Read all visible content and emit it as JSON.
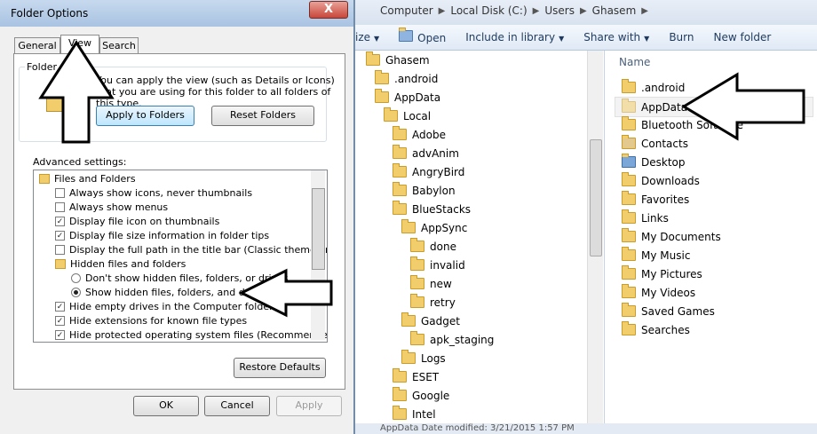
{
  "explorer": {
    "breadcrumb": [
      "Computer",
      "Local Disk (C:)",
      "Users",
      "Ghasem"
    ],
    "toolbar": {
      "organize": "ize",
      "open": "Open",
      "include": "Include in library",
      "share": "Share with",
      "burn": "Burn",
      "new_folder": "New folder"
    },
    "nav_tree": [
      {
        "label": "Ghasem"
      },
      {
        "label": ".android"
      },
      {
        "label": "AppData"
      },
      {
        "label": "Local"
      },
      {
        "label": "Adobe"
      },
      {
        "label": "advAnim"
      },
      {
        "label": "AngryBird"
      },
      {
        "label": "Babylon"
      },
      {
        "label": "BlueStacks"
      },
      {
        "label": "AppSync"
      },
      {
        "label": "done"
      },
      {
        "label": "invalid"
      },
      {
        "label": "new"
      },
      {
        "label": "retry"
      },
      {
        "label": "Gadget"
      },
      {
        "label": "apk_staging"
      },
      {
        "label": "Logs"
      },
      {
        "label": "ESET"
      },
      {
        "label": "Google"
      },
      {
        "label": "Intel"
      }
    ],
    "list_header": "Name",
    "items": [
      {
        "label": ".android"
      },
      {
        "label": "AppData"
      },
      {
        "label": "Bluetooth Software"
      },
      {
        "label": "Contacts"
      },
      {
        "label": "Desktop"
      },
      {
        "label": "Downloads"
      },
      {
        "label": "Favorites"
      },
      {
        "label": "Links"
      },
      {
        "label": "My Documents"
      },
      {
        "label": "My Music"
      },
      {
        "label": "My Pictures"
      },
      {
        "label": "My Videos"
      },
      {
        "label": "Saved Games"
      },
      {
        "label": "Searches"
      }
    ],
    "status": "AppData    Date modified: 3/21/2015 1:57 PM"
  },
  "dialog": {
    "title": "Folder Options",
    "close": "X",
    "tabs": [
      "General",
      "View",
      "Search"
    ],
    "folder_views_label": "Folder views",
    "folder_views_text": "You can apply the view (such as Details or Icons) that you are using for this folder to all folders of this type.",
    "apply_to_folders": "Apply to Folders",
    "reset_folders": "Reset Folders",
    "advanced_label": "Advanced settings:",
    "settings": [
      {
        "label": "Files and Folders",
        "kind": "folder"
      },
      {
        "label": "Always show icons, never thumbnails",
        "kind": "check",
        "checked": false
      },
      {
        "label": "Always show menus",
        "kind": "check",
        "checked": false
      },
      {
        "label": "Display file icon on thumbnails",
        "kind": "check",
        "checked": true
      },
      {
        "label": "Display file size information in folder tips",
        "kind": "check",
        "checked": true
      },
      {
        "label": "Display the full path in the title bar (Classic theme only)",
        "kind": "check",
        "checked": false
      },
      {
        "label": "Hidden files and folders",
        "kind": "folder"
      },
      {
        "label": "Don't show hidden files, folders, or drives",
        "kind": "radio",
        "checked": false
      },
      {
        "label": "Show hidden files, folders, and drives",
        "kind": "radio",
        "checked": true
      },
      {
        "label": "Hide empty drives in the Computer folder",
        "kind": "check",
        "checked": true
      },
      {
        "label": "Hide extensions for known file types",
        "kind": "check",
        "checked": true
      },
      {
        "label": "Hide protected operating system files (Recommended)",
        "kind": "check",
        "checked": true
      }
    ],
    "restore_defaults": "Restore Defaults",
    "ok": "OK",
    "cancel": "Cancel",
    "apply": "Apply"
  }
}
